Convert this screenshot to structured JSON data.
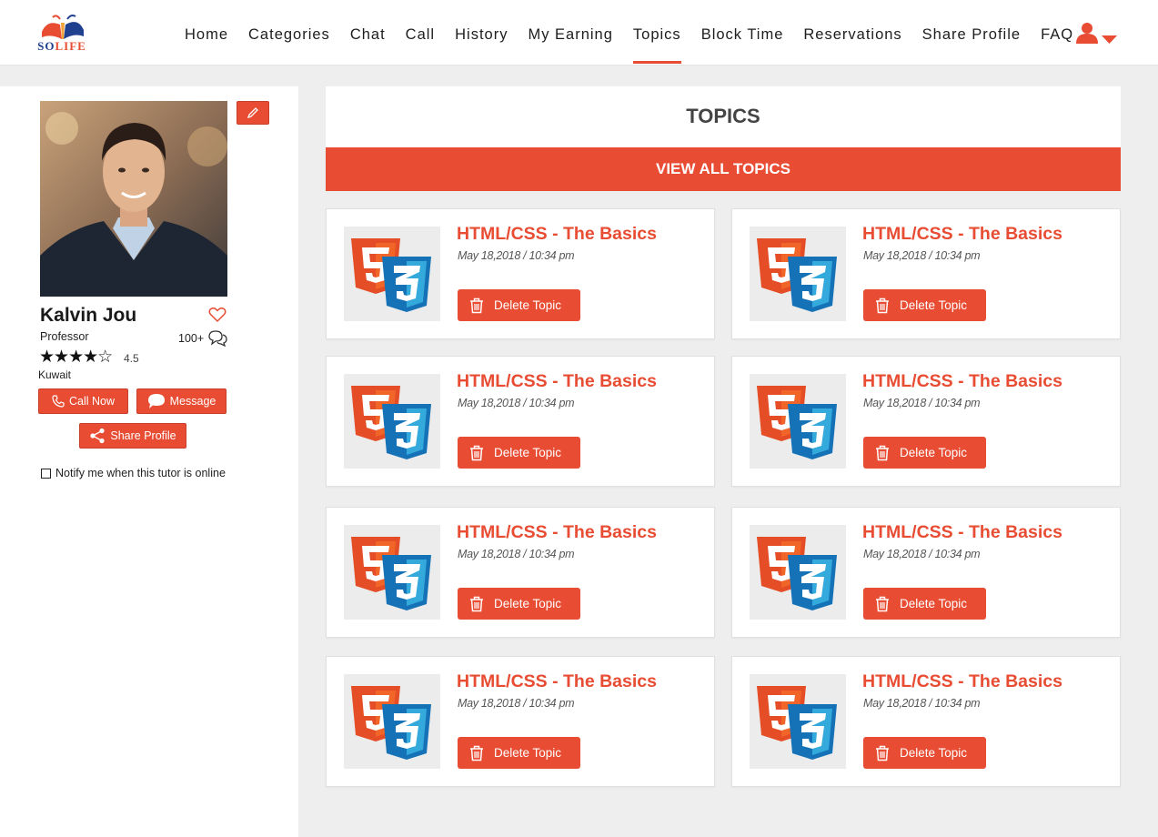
{
  "brand": {
    "logo_so": "SO",
    "logo_life": "LIFE",
    "accent": "#e84c33",
    "logo_blue": "#1f3f8f"
  },
  "nav": {
    "items": [
      {
        "label": "Home"
      },
      {
        "label": "Categories"
      },
      {
        "label": "Chat"
      },
      {
        "label": "Call"
      },
      {
        "label": "History"
      },
      {
        "label": "My Earning"
      },
      {
        "label": "Topics",
        "active": true
      },
      {
        "label": "Block Time"
      },
      {
        "label": "Reservations"
      },
      {
        "label": "Share Profile"
      },
      {
        "label": "FAQ"
      }
    ],
    "user_icon": "user-icon",
    "dropdown_icon": "caret-down-icon"
  },
  "profile": {
    "name": "Kalvin Jou",
    "title": "Professor",
    "reviews": "100+",
    "rating": "4.5",
    "stars": "★★★★☆",
    "rating_value": 4.5,
    "location": "Kuwait",
    "call_label": "Call Now",
    "message_label": "Message",
    "share_label": "Share Profile",
    "notify_label": "Notify me when this tutor is online",
    "notify_checked": false
  },
  "topics": {
    "heading": "TOPICS",
    "view_all_label": "VIEW ALL TOPICS",
    "cards": [
      {
        "title": "HTML/CSS - The Basics",
        "date": "May 18,2018 / 10:34 pm",
        "delete_label": "Delete Topic"
      },
      {
        "title": "HTML/CSS - The Basics",
        "date": "May 18,2018 / 10:34 pm",
        "delete_label": "Delete Topic"
      },
      {
        "title": "HTML/CSS - The Basics",
        "date": "May 18,2018 / 10:34 pm",
        "delete_label": "Delete Topic"
      },
      {
        "title": "HTML/CSS - The Basics",
        "date": "May 18,2018 / 10:34 pm",
        "delete_label": "Delete Topic"
      },
      {
        "title": "HTML/CSS - The Basics",
        "date": "May 18,2018 / 10:34 pm",
        "delete_label": "Delete Topic"
      },
      {
        "title": "HTML/CSS - The Basics",
        "date": "May 18,2018 / 10:34 pm",
        "delete_label": "Delete Topic"
      },
      {
        "title": "HTML/CSS - The Basics",
        "date": "May 18,2018 / 10:34 pm",
        "delete_label": "Delete Topic"
      },
      {
        "title": "HTML/CSS - The Basics",
        "date": "May 18,2018 / 10:34 pm",
        "delete_label": "Delete Topic"
      }
    ]
  }
}
